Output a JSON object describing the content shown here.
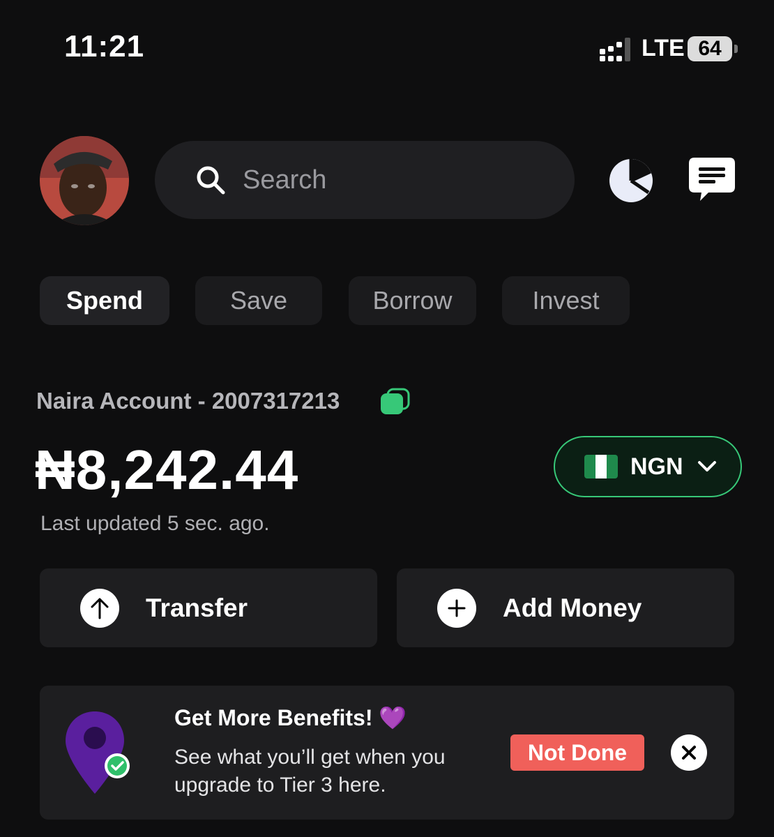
{
  "status_bar": {
    "time": "11:21",
    "network": "LTE",
    "battery": "64"
  },
  "header": {
    "search_placeholder": "Search"
  },
  "tabs": [
    {
      "label": "Spend",
      "active": true
    },
    {
      "label": "Save",
      "active": false
    },
    {
      "label": "Borrow",
      "active": false
    },
    {
      "label": "Invest",
      "active": false
    }
  ],
  "account": {
    "label": "Naira Account - 2007317213",
    "balance": "₦8,242.44",
    "updated": "Last updated 5 sec. ago.",
    "currency": "NGN"
  },
  "actions": {
    "transfer": "Transfer",
    "add_money": "Add Money"
  },
  "promo": {
    "title": "Get More Benefits! 💜",
    "body": "See what you’ll get when you upgrade to Tier 3 here.",
    "status": "Not Done"
  },
  "colors": {
    "accent_green": "#37c878",
    "not_done_red": "#f0605a",
    "pin_purple": "#5a1f9e"
  },
  "icons": [
    "search-icon",
    "pie-chart-icon",
    "message-icon",
    "copy-icon",
    "chevron-down-icon",
    "arrow-up-icon",
    "plus-icon",
    "location-pin-icon",
    "close-icon"
  ]
}
